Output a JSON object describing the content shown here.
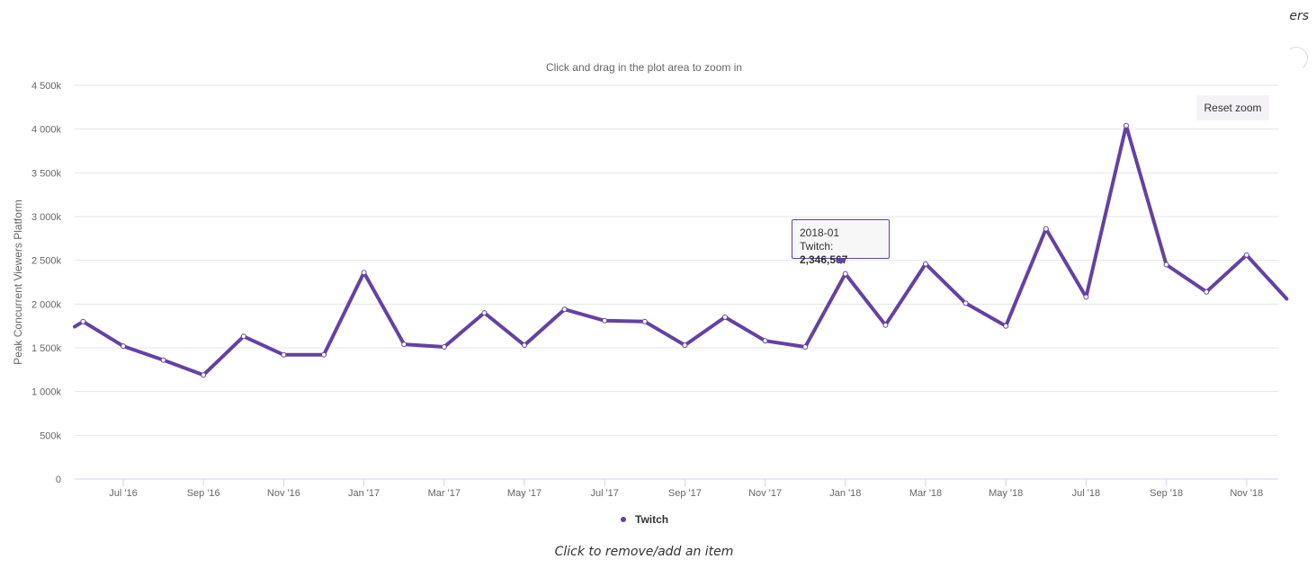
{
  "header": {
    "corner_text": "ers",
    "subtitle": "Click and drag in the plot area to zoom in"
  },
  "controls": {
    "reset_zoom_label": "Reset zoom"
  },
  "tooltip": {
    "date": "2018-01",
    "series_label": "Twitch: ",
    "value": "2,346,567"
  },
  "legend": {
    "items": [
      {
        "name": "Twitch",
        "color": "#6441a4"
      }
    ]
  },
  "footer": {
    "note": "Click to remove/add an item"
  },
  "chart_data": {
    "type": "line",
    "title": "",
    "xlabel": "",
    "ylabel": "Peak Concurrent Viewers Platform",
    "ylim": [
      0,
      4500000
    ],
    "y_ticks": [
      0,
      500000,
      1000000,
      1500000,
      2000000,
      2500000,
      3000000,
      3500000,
      4000000,
      4500000
    ],
    "y_tick_labels": [
      "0",
      "500k",
      "1 000k",
      "1 500k",
      "2 000k",
      "2 500k",
      "3 000k",
      "3 500k",
      "4 000k",
      "4 500k"
    ],
    "x_tick_labels": [
      "Jul '16",
      "Sep '16",
      "Nov '16",
      "Jan '17",
      "Mar '17",
      "May '17",
      "Jul '17",
      "Sep '17",
      "Nov '17",
      "Jan '18",
      "Mar '18",
      "May '18",
      "Jul '18",
      "Sep '18",
      "Nov '18"
    ],
    "x_tick_dates": [
      "2016-07",
      "2016-09",
      "2016-11",
      "2017-01",
      "2017-03",
      "2017-05",
      "2017-07",
      "2017-09",
      "2017-11",
      "2018-01",
      "2018-03",
      "2018-05",
      "2018-07",
      "2018-09",
      "2018-11"
    ],
    "grid": true,
    "legend_position": "bottom-center",
    "colors": {
      "series": "#6441a4",
      "grid": "#e6e6e6",
      "axis": "#ccd6eb"
    },
    "series": [
      {
        "name": "Twitch",
        "x": [
          "2016-06",
          "2016-07",
          "2016-08",
          "2016-09",
          "2016-10",
          "2016-11",
          "2016-12",
          "2017-01",
          "2017-02",
          "2017-03",
          "2017-04",
          "2017-05",
          "2017-06",
          "2017-07",
          "2017-08",
          "2017-09",
          "2017-10",
          "2017-11",
          "2017-12",
          "2018-01",
          "2018-02",
          "2018-03",
          "2018-04",
          "2018-05",
          "2018-06",
          "2018-07",
          "2018-08",
          "2018-09",
          "2018-10",
          "2018-11",
          "2018-12"
        ],
        "values": [
          1800000,
          1520000,
          1360000,
          1190000,
          1630000,
          1420000,
          1420000,
          2360000,
          1540000,
          1510000,
          1900000,
          1530000,
          1940000,
          1810000,
          1800000,
          1530000,
          1850000,
          1580000,
          1510000,
          2346567,
          1760000,
          2460000,
          2010000,
          1750000,
          2860000,
          2080000,
          4040000,
          2450000,
          2140000,
          2560000,
          2060000
        ]
      }
    ]
  }
}
